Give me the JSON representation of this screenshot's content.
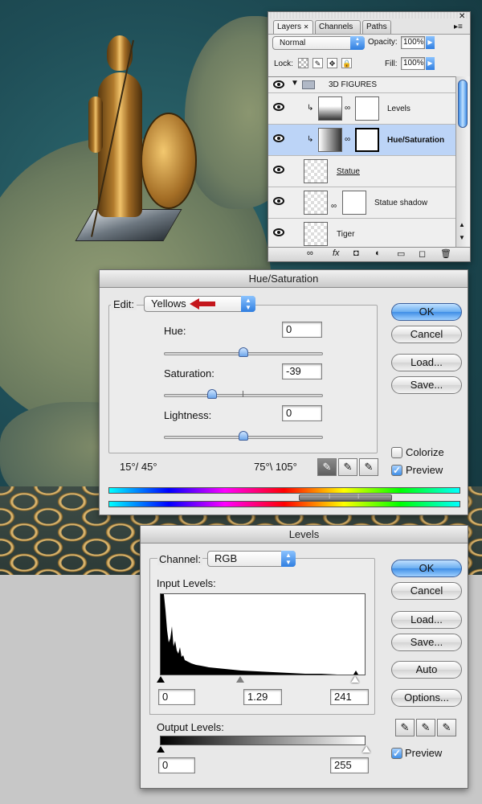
{
  "layers_panel": {
    "tabs": [
      "Layers",
      "Channels",
      "Paths"
    ],
    "blend_mode": "Normal",
    "opacity_label": "Opacity:",
    "opacity_value": "100%",
    "lock_label": "Lock:",
    "fill_label": "Fill:",
    "fill_value": "100%",
    "layers": [
      {
        "name": "3D FIGURES",
        "type": "group"
      },
      {
        "name": "Levels",
        "type": "adjustment"
      },
      {
        "name": "Hue/Saturation",
        "type": "adjustment",
        "selected": true
      },
      {
        "name": "Statue",
        "type": "layer"
      },
      {
        "name": "Statue shadow",
        "type": "layer"
      },
      {
        "name": "Tiger",
        "type": "layer"
      }
    ]
  },
  "hue_saturation": {
    "title": "Hue/Saturation",
    "edit_label": "Edit:",
    "edit_value": "Yellows",
    "hue_label": "Hue:",
    "hue_value": "0",
    "saturation_label": "Saturation:",
    "saturation_value": "-39",
    "lightness_label": "Lightness:",
    "lightness_value": "0",
    "range_left": "15°/ 45°",
    "range_right": "75°\\ 105°",
    "ok": "OK",
    "cancel": "Cancel",
    "load": "Load...",
    "save": "Save...",
    "colorize": "Colorize",
    "colorize_checked": false,
    "preview": "Preview",
    "preview_checked": true
  },
  "levels": {
    "title": "Levels",
    "channel_label": "Channel:",
    "channel_value": "RGB",
    "input_label": "Input Levels:",
    "input_black": "0",
    "input_gamma": "1.29",
    "input_white": "241",
    "output_label": "Output Levels:",
    "output_black": "0",
    "output_white": "255",
    "ok": "OK",
    "cancel": "Cancel",
    "load": "Load...",
    "save": "Save...",
    "auto": "Auto",
    "options": "Options...",
    "preview": "Preview",
    "preview_checked": true
  },
  "icons": {
    "check": "✓",
    "eyedropper": "✎",
    "arrows": "▲▼"
  }
}
